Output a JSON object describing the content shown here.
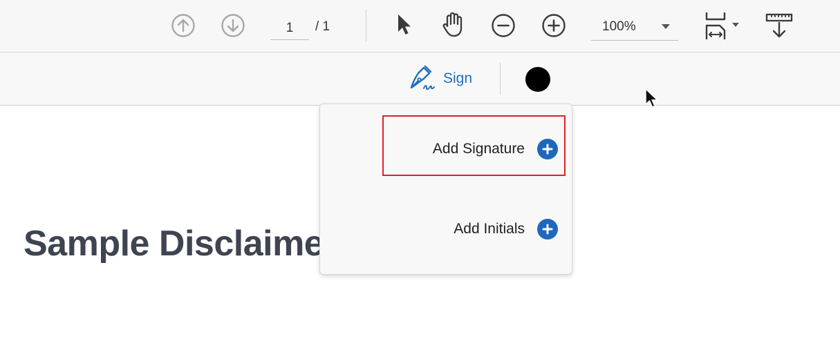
{
  "toolbar": {
    "page_current": "1",
    "page_total": "/ 1",
    "zoom_value": "100%",
    "icons": [
      "prev-page-icon",
      "next-page-icon",
      "select-arrow-icon",
      "hand-pan-icon",
      "zoom-out-icon",
      "zoom-in-icon",
      "fit-width-icon",
      "download-icon"
    ]
  },
  "subbar": {
    "sign_label": "Sign",
    "ink_color": "#000000"
  },
  "document": {
    "heading": "Sample Disclaimer"
  },
  "menu": {
    "items": [
      {
        "label": "Add Signature"
      },
      {
        "label": "Add Initials"
      }
    ],
    "accent_color": "#1f67bd",
    "highlight_color": "#e02020"
  }
}
